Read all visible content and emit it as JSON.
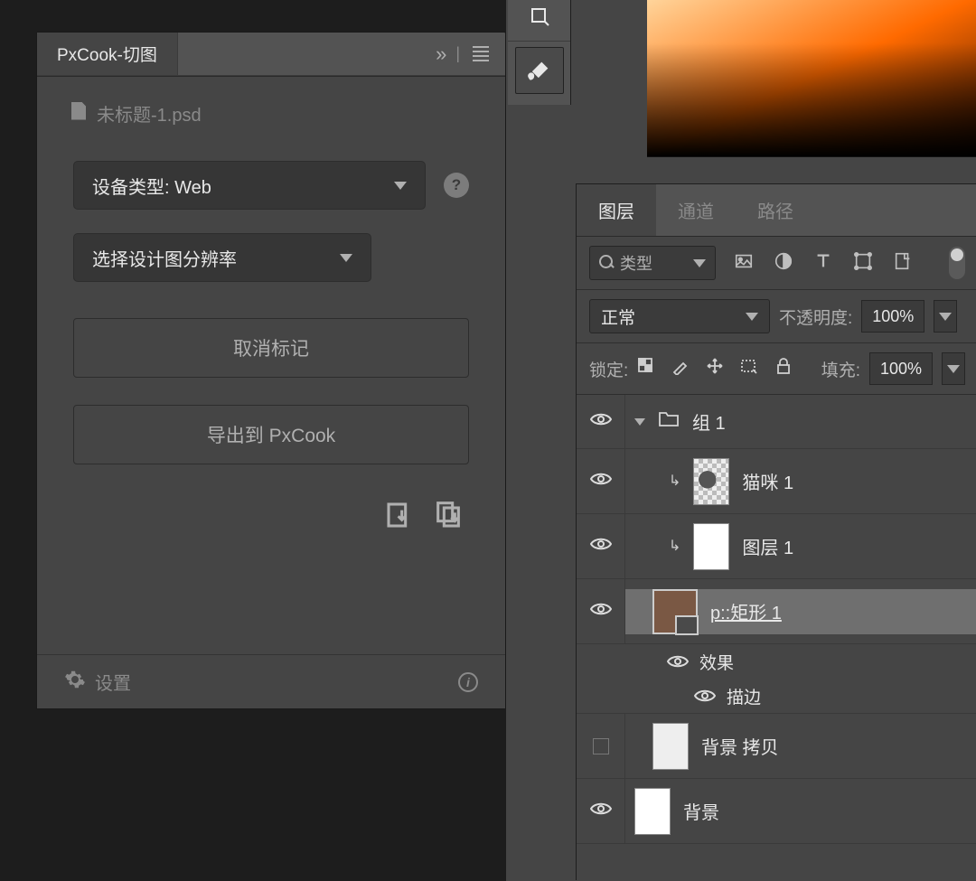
{
  "pxcook": {
    "title": "PxCook-切图",
    "file": "未标题-1.psd",
    "device_type_label": "设备类型: Web",
    "resolution_label": "选择设计图分辨率",
    "btn_cancel_mark": "取消标记",
    "btn_export": "导出到 PxCook",
    "settings_label": "设置"
  },
  "layers_panel": {
    "tabs": {
      "layers": "图层",
      "channels": "通道",
      "paths": "路径"
    },
    "filter_type": "类型",
    "blend_mode": "正常",
    "opacity_label": "不透明度:",
    "opacity_value": "100%",
    "lock_label": "锁定:",
    "fill_label": "填充:",
    "fill_value": "100%",
    "layers": {
      "group1": "组 1",
      "cat1": "猫咪 1",
      "layer1": "图层 1",
      "shape1": "p::矩形 1",
      "effects": "效果",
      "stroke": "描边",
      "bg_copy": "背景 拷贝",
      "bg": "背景"
    }
  }
}
